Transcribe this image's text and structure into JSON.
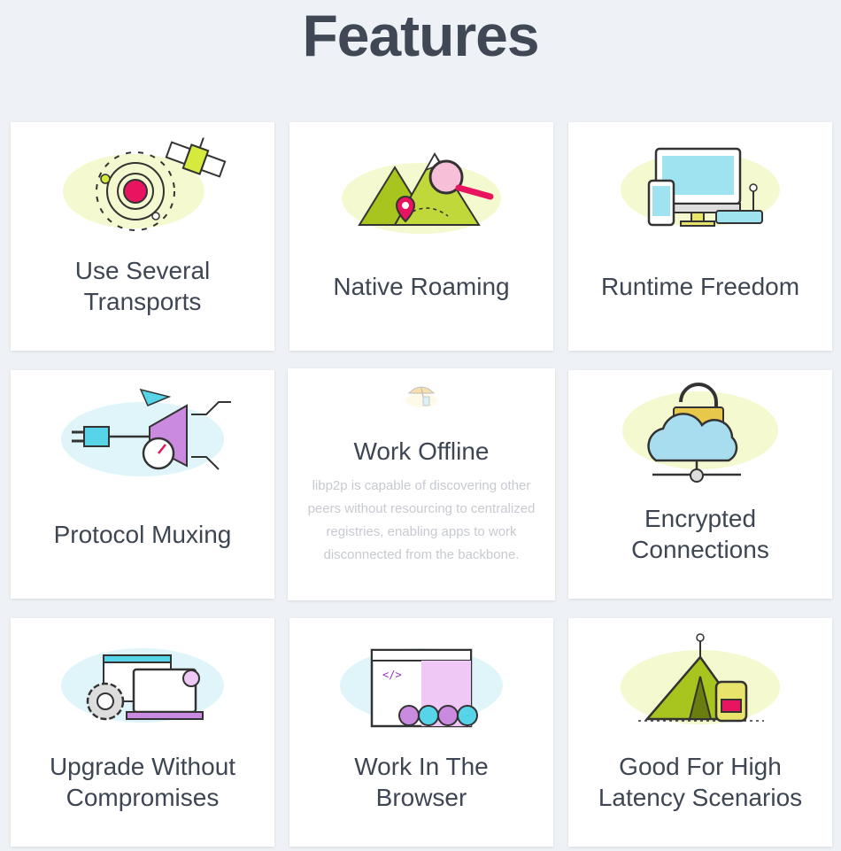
{
  "page": {
    "title": "Features"
  },
  "cards": [
    {
      "label": "Use Several\nTransports",
      "icon": "satellite-orbit-icon"
    },
    {
      "label": "Native Roaming",
      "icon": "mountain-magnifier-icon"
    },
    {
      "label": "Runtime Freedom",
      "icon": "devices-router-icon"
    },
    {
      "label": "Protocol Muxing",
      "icon": "plug-gauge-icon"
    },
    {
      "label": "Work Offline",
      "icon": "beach-umbrella-icon",
      "description": "libp2p is capable of discovering other peers without resourcing to centralized registries, enabling apps to work disconnected from the backbone."
    },
    {
      "label": "Encrypted\nConnections",
      "icon": "cloud-lock-icon"
    },
    {
      "label": "Upgrade Without\nCompromises",
      "icon": "laptop-gear-icon"
    },
    {
      "label": "Work In The\nBrowser",
      "icon": "browser-window-icon"
    },
    {
      "label": "Good For High\nLatency Scenarios",
      "icon": "tent-backpack-icon"
    }
  ],
  "colors": {
    "background": "#eef1f6",
    "title": "#404856",
    "label": "#3f4653",
    "accent_pink": "#e8145f",
    "accent_green": "#a8c41e",
    "accent_cyan": "#58d4e8",
    "accent_purple": "#c98ae0"
  }
}
